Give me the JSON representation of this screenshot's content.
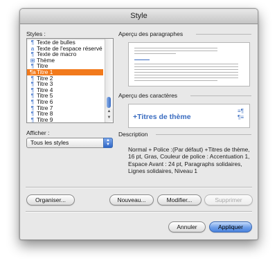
{
  "window": {
    "title": "Style"
  },
  "styles": {
    "label": "Styles :",
    "items": [
      {
        "label": "Texte de bulles",
        "icon": "paragraph-style-icon"
      },
      {
        "label": "Texte de l'espace réservé",
        "icon": "character-style-icon"
      },
      {
        "label": "Texte de macro",
        "icon": "paragraph-style-icon"
      },
      {
        "label": "Thème",
        "icon": "table-style-icon"
      },
      {
        "label": "Titre",
        "icon": "paragraph-style-icon"
      },
      {
        "label": "Titre 1",
        "icon": "linked-style-icon",
        "selected": true
      },
      {
        "label": "Titre 2",
        "icon": "paragraph-style-icon"
      },
      {
        "label": "Titre 3",
        "icon": "paragraph-style-icon"
      },
      {
        "label": "Titre 4",
        "icon": "paragraph-style-icon"
      },
      {
        "label": "Titre 5",
        "icon": "paragraph-style-icon"
      },
      {
        "label": "Titre 6",
        "icon": "paragraph-style-icon"
      },
      {
        "label": "Titre 7",
        "icon": "paragraph-style-icon"
      },
      {
        "label": "Titre 8",
        "icon": "paragraph-style-icon"
      },
      {
        "label": "Titre 9",
        "icon": "paragraph-style-icon"
      }
    ]
  },
  "show": {
    "label": "Afficher :",
    "value": "Tous les styles"
  },
  "paragraph_preview": {
    "label": "Aperçu des paragraphes"
  },
  "character_preview": {
    "label": "Aperçu des caractères",
    "text": "+Titres de thème"
  },
  "description": {
    "label": "Description",
    "text": "Normal + Police :(Par défaut) +Titres de thème, 16 pt, Gras, Couleur de police : Accentuation 1, Espace Avant :  24 pt, Paragraphs solidaires, Lignes solidaires, Niveau 1"
  },
  "buttons": {
    "organize": "Organiser...",
    "new": "Nouveau...",
    "modify": "Modifier...",
    "delete": "Supprimer",
    "cancel": "Annuler",
    "apply": "Appliquer"
  },
  "colors": {
    "selection": "#f27a1c",
    "accent": "#3a6cc0"
  }
}
